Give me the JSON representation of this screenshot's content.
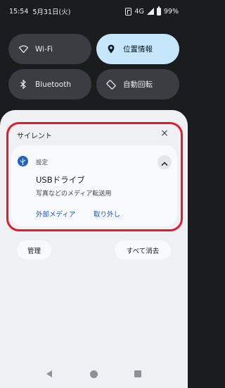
{
  "status_bar": {
    "time": "15:54",
    "date": "5月31日(火)",
    "network": "4G",
    "battery": "99%"
  },
  "quick_settings": {
    "tiles": [
      {
        "label": "Wi-Fi",
        "icon": "wifi-icon",
        "active": false
      },
      {
        "label": "位置情報",
        "icon": "location-pin-icon",
        "active": true
      },
      {
        "label": "Bluetooth",
        "icon": "bluetooth-icon",
        "active": false
      },
      {
        "label": "自動回転",
        "icon": "auto-rotate-icon",
        "active": false
      }
    ]
  },
  "notifications": {
    "section_header": "サイレント",
    "dismiss_symbol": "×",
    "card": {
      "app_name": "設定",
      "app_icon": "usb-icon",
      "title": "USBドライブ",
      "text": "写真などのメディア転送用",
      "actions": [
        "外部メディア",
        "取り外し"
      ]
    },
    "manage_label": "管理",
    "clear_all_label": "すべて消去"
  },
  "colors": {
    "highlight": "#e21a2c",
    "accent": "#1c57b7",
    "active_tile": "#c6e6fb"
  }
}
